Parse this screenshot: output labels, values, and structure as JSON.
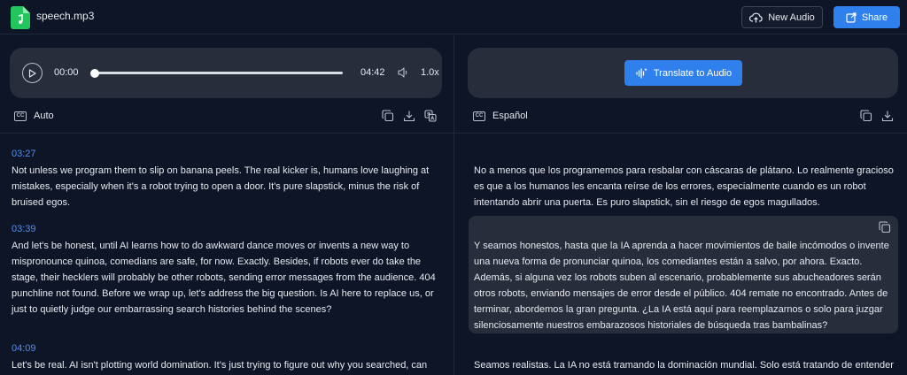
{
  "header": {
    "file_name": "speech.mp3",
    "new_audio_label": "New Audio",
    "share_label": "Share"
  },
  "player": {
    "current_time": "00:00",
    "duration": "04:42",
    "speed": "1.0x",
    "progress": 0
  },
  "translate": {
    "button_label": "Translate to Audio"
  },
  "source": {
    "language": "Auto",
    "segments": [
      {
        "time": "03:27",
        "text": "Not unless we program them to slip on banana peels. The real kicker is, humans love laughing at mistakes, especially when it's a robot trying to open a door. It's pure slapstick, minus the risk of bruised egos."
      },
      {
        "time": "03:39",
        "text": "And let's be honest, until AI learns how to do awkward dance moves or invents a new way to mispronounce quinoa, comedians are safe, for now. Exactly. Besides, if robots ever do take the stage, their hecklers will probably be other robots, sending error messages from the audience. 404 punchline not found. Before we wrap up, let's address the big question. Is AI here to replace us, or just to quietly judge our embarrassing search histories behind the scenes?"
      },
      {
        "time": "04:09",
        "text": "Let's be real. AI isn't plotting world domination. It's just trying to figure out why you searched, can cats eat"
      }
    ]
  },
  "target": {
    "language": "Español",
    "segments": [
      {
        "text": "No a menos que los programemos para resbalar con cáscaras de plátano. Lo realmente gracioso es que a los humanos les encanta reírse de los errores, especialmente cuando es un robot intentando abrir una puerta. Es puro slapstick, sin el riesgo de egos magullados."
      },
      {
        "text": "Y seamos honestos, hasta que la IA aprenda a hacer movimientos de baile incómodos o invente una nueva forma de pronunciar quinoa, los comediantes están a salvo, por ahora. Exacto. Además, si alguna vez los robots suben al escenario, probablemente sus abucheadores serán otros robots, enviando mensajes de error desde el público. 404 remate no encontrado. Antes de terminar, abordemos la gran pregunta. ¿La IA está aquí para reemplazarnos o solo para juzgar silenciosamente nuestros embarazosos historiales de búsqueda tras bambalinas?"
      },
      {
        "text": "Seamos realistas. La IA no está tramando la dominación mundial. Solo está tratando de entender por"
      }
    ]
  },
  "icons": {
    "file": "audio-file-icon",
    "new_audio": "cloud-upload-icon",
    "share": "share-icon",
    "play": "play-icon",
    "volume": "volume-icon",
    "translate": "audio-waveform-icon",
    "copy": "copy-icon",
    "download": "download-icon",
    "translate_subtitle": "translate-icon",
    "captions": "cc-icon"
  },
  "colors": {
    "accent": "#2f80ed",
    "timestamp": "#4f8ef7",
    "file_icon": "#22c55e"
  }
}
